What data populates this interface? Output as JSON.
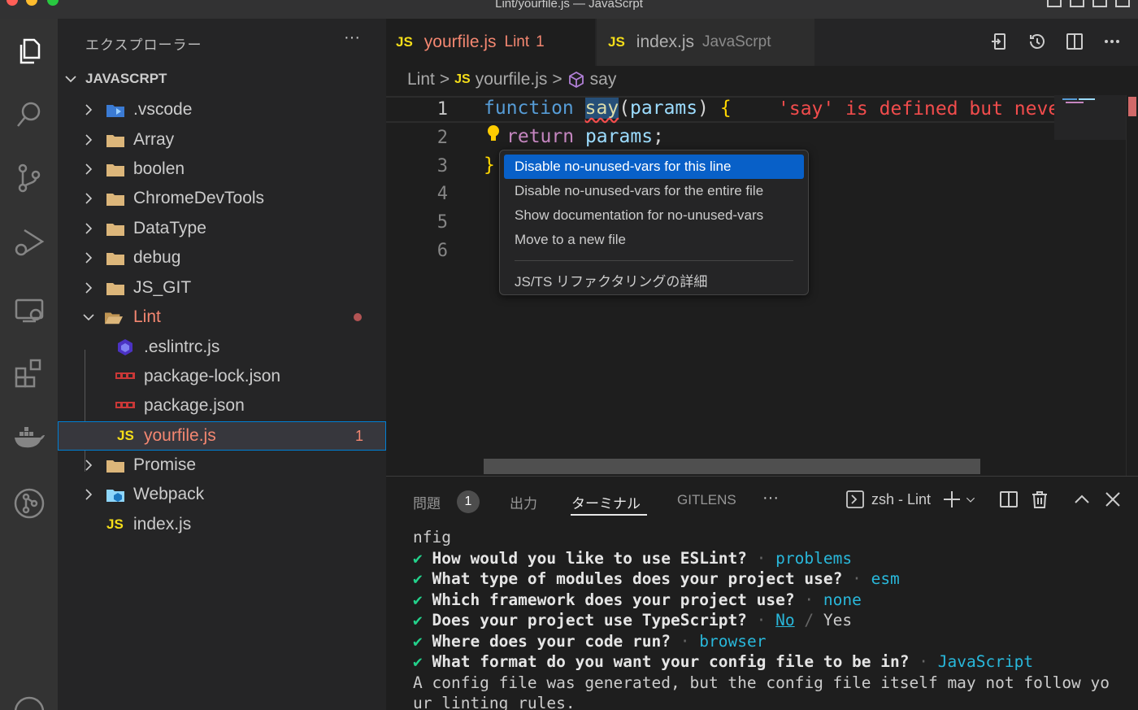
{
  "window": {
    "title": "Lint/yourfile.js — JavaScrpt"
  },
  "sidebar": {
    "title": "エクスプローラー",
    "more": "···",
    "section": "JAVASCRPT",
    "items": [
      {
        "label": ".vscode"
      },
      {
        "label": "Array"
      },
      {
        "label": "boolen"
      },
      {
        "label": "ChromeDevTools"
      },
      {
        "label": "DataType"
      },
      {
        "label": "debug"
      },
      {
        "label": "JS_GIT"
      },
      {
        "label": "Lint"
      },
      {
        "label": ".eslintrc.js"
      },
      {
        "label": "package-lock.json"
      },
      {
        "label": "package.json"
      },
      {
        "label": "yourfile.js",
        "errors": "1",
        "badge": "JS"
      },
      {
        "label": "Promise"
      },
      {
        "label": "Webpack"
      },
      {
        "label": "index.js",
        "badge": "JS"
      }
    ]
  },
  "tabs": [
    {
      "badge": "JS",
      "label": "yourfile.js",
      "desc": "Lint",
      "count": "1"
    },
    {
      "badge": "JS",
      "label": "index.js",
      "desc": "JavaScrpt"
    }
  ],
  "breadcrumb": {
    "folder": "Lint",
    "sep": ">",
    "badge": "JS",
    "file": "yourfile.js",
    "symbol": "say"
  },
  "editor": {
    "line_numbers": [
      "1",
      "2",
      "3",
      "4",
      "5",
      "6"
    ],
    "code": {
      "l1_kw": "function",
      "l1_fn": "say",
      "l1_open": "(",
      "l1_param": "params",
      "l1_close": ")",
      "l1_brace": "{",
      "l2_kw": "return",
      "l2_param": "params",
      "l2_semi": ";",
      "l3_brace": "}"
    },
    "inline_error": "'say' is defined but never used"
  },
  "quick_fix_menu": {
    "items": [
      "Disable no-unused-vars for this line",
      "Disable no-unused-vars for the entire file",
      "Show documentation for no-unused-vars",
      "Move to a new file"
    ],
    "extra": "JS/TS リファクタリングの詳細"
  },
  "panel": {
    "tabs": {
      "problems": "問題",
      "problems_count": "1",
      "output": "出力",
      "terminal": "ターミナル",
      "gitlens": "GITLENS",
      "more": "···"
    },
    "terminal_name": "zsh - Lint",
    "terminal_lines": {
      "l0": "nfig",
      "check": "✔",
      "dot": "·",
      "q1": "How would you like to use ESLint?",
      "a1": "problems",
      "q2": "What type of modules does your project use?",
      "a2": "esm",
      "q3": "Which framework does your project use?",
      "a3": "none",
      "q4": "Does your project use TypeScript?",
      "a4_sel": "No",
      "a4_sep": "/",
      "a4_alt": "Yes",
      "q5": "Where does your code run?",
      "a5": "browser",
      "q6": "What format do you want your config file to be in?",
      "a6": "JavaScript",
      "l7": "A config file was generated, but the config file itself may not follow yo",
      "l8": "ur linting rules."
    }
  },
  "colors": {
    "accent": "#0860c8",
    "error": "#f14c4c",
    "js_badge": "#f5de19",
    "folder": "#dcb67a"
  }
}
